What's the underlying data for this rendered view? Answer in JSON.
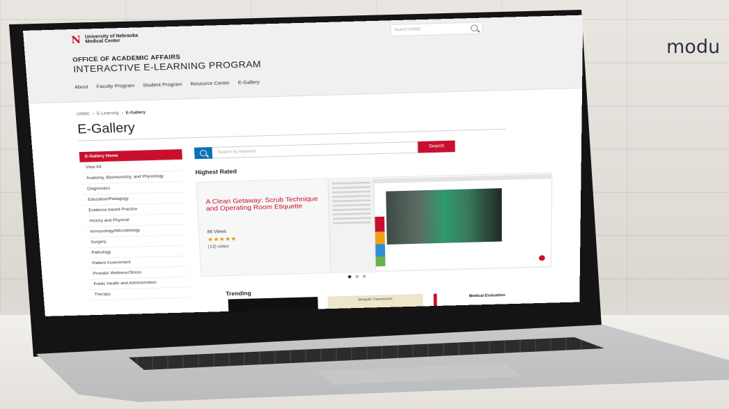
{
  "background": {
    "corner_text": "modu"
  },
  "header": {
    "logo_line1": "University of Nebraska",
    "logo_line2": "Medical Center",
    "search_placeholder": "Search UNMC",
    "department": "OFFICE OF ACADEMIC AFFAIRS",
    "program": "INTERACTIVE E-LEARNING PROGRAM",
    "nav": [
      "About",
      "Faculty Program",
      "Student Program",
      "Resource Center",
      "E-Gallery"
    ]
  },
  "breadcrumb": [
    "UNMC",
    "E-Learning",
    "E-Gallery"
  ],
  "page_title": "E-Gallery",
  "sidebar": {
    "items": [
      {
        "label": "E-Gallery Home",
        "active": true
      },
      {
        "label": "View All"
      },
      {
        "label": "Anatomy, Biochemistry, and Physiology"
      },
      {
        "label": "Diagnostics"
      },
      {
        "label": "Education/Pedagogy"
      },
      {
        "label": "Evidence-based Practice"
      },
      {
        "label": "History and Physical"
      },
      {
        "label": "Immunology/Microbiology"
      },
      {
        "label": "Surgery"
      },
      {
        "label": "Pathology"
      },
      {
        "label": "Patient Assessment"
      },
      {
        "label": "Provider Wellness/Stress"
      },
      {
        "label": "Public Health and Administration"
      },
      {
        "label": "Therapy"
      }
    ]
  },
  "search": {
    "placeholder": "Search by keyword",
    "button": "Search"
  },
  "highest_rated": {
    "heading": "Highest Rated",
    "title": "A Clean Getaway: Scrub Technique and Operating Room Etiquette",
    "views": "86 Views",
    "stars": "★★★★★",
    "votes": "(13) votes"
  },
  "trending": {
    "heading": "Trending",
    "card2_title": "Mosquito Transmission",
    "card3_title": "Medical Evaluation"
  },
  "colors": {
    "accent": "#c8102e",
    "search_blue": "#0b6fb6",
    "star": "#e88a00"
  }
}
